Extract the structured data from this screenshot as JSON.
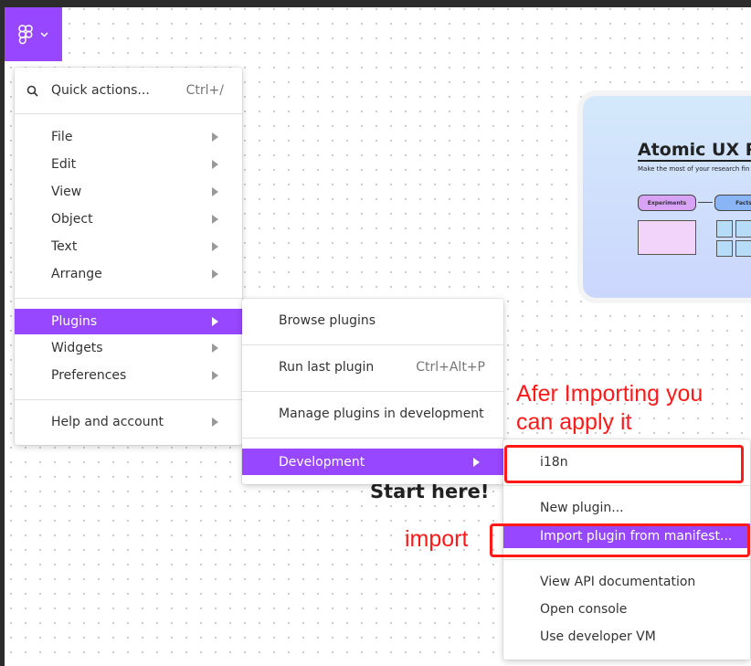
{
  "main_menu": {
    "search": {
      "label": "Quick actions...",
      "shortcut": "Ctrl+/"
    },
    "items": [
      {
        "label": "File"
      },
      {
        "label": "Edit"
      },
      {
        "label": "View"
      },
      {
        "label": "Object"
      },
      {
        "label": "Text"
      },
      {
        "label": "Arrange"
      },
      {
        "label": "Plugins"
      },
      {
        "label": "Widgets"
      },
      {
        "label": "Preferences"
      },
      {
        "label": "Help and account"
      }
    ]
  },
  "plugins_menu": {
    "items": [
      {
        "label": "Browse plugins"
      },
      {
        "label": "Run last plugin",
        "shortcut": "Ctrl+Alt+P"
      },
      {
        "label": "Manage plugins in development"
      },
      {
        "label": "Development"
      }
    ]
  },
  "development_menu": {
    "items": [
      {
        "label": "i18n"
      },
      {
        "label": "New plugin..."
      },
      {
        "label": "Import plugin from manifest..."
      },
      {
        "label": "View API documentation"
      },
      {
        "label": "Open console"
      },
      {
        "label": "Use developer VM"
      }
    ]
  },
  "canvas": {
    "card": {
      "title": "Atomic UX Re",
      "subtitle": "Make the most of your research fin",
      "node1": "Experiments",
      "node2": "Facts"
    },
    "start_text": "Start here!"
  },
  "annotations": {
    "note_line1": "Afer Importing  you",
    "note_line2": "can apply it",
    "import_label": "import",
    "color": "#ff1a1a"
  },
  "colors": {
    "accent": "#9747ff"
  }
}
